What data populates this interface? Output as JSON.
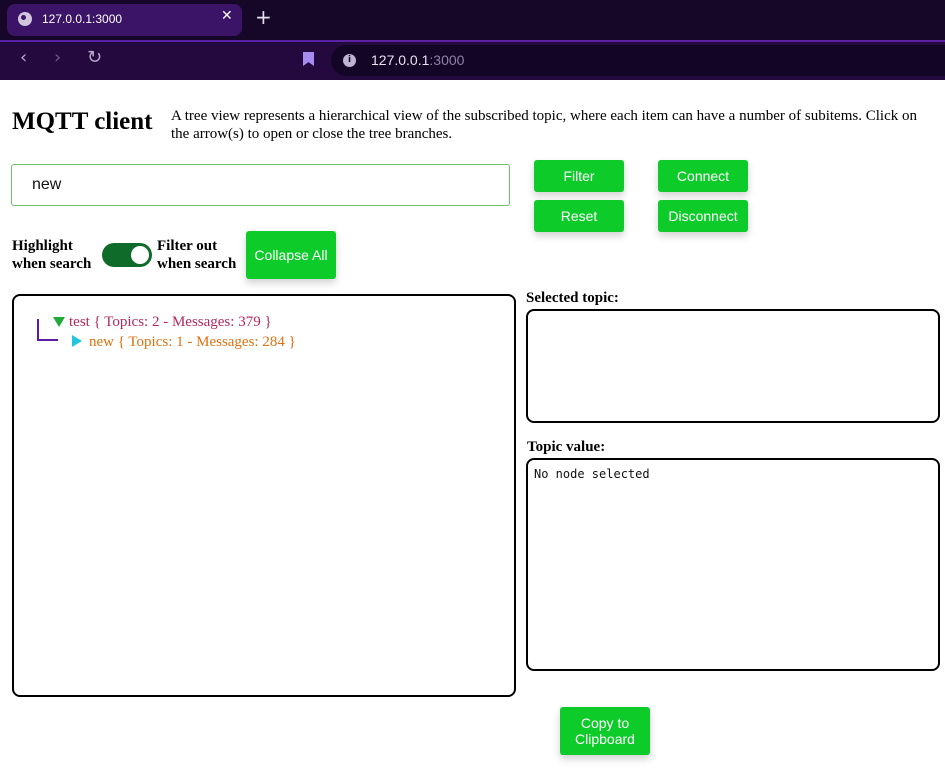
{
  "browser": {
    "tab_title": "127.0.0.1:3000",
    "tab_close": "✕",
    "new_tab": "+",
    "nav": {
      "back": "‹",
      "forward": "›",
      "reload": "↻"
    },
    "url_host": "127.0.0.1",
    "url_port": ":3000",
    "info_glyph": "i"
  },
  "header": {
    "title": "MQTT client",
    "description": "A tree view represents a hierarchical view of the subscribed topic, where each item can have a number of subitems. Click on the arrow(s) to open or close the tree branches."
  },
  "search": {
    "value": "new"
  },
  "buttons": {
    "filter": "Filter",
    "reset": "Reset",
    "connect": "Connect",
    "disconnect": "Disconnect",
    "collapse": "Collapse All",
    "copy": "Copy to Clipboard"
  },
  "labels": {
    "highlight": "Highlight when search",
    "filter_out": "Filter out when search"
  },
  "toggle": {
    "on": true
  },
  "tree": [
    {
      "label": "test { Topics: 2 - Messages: 379 }",
      "color": "#b3275f",
      "expanded": true
    },
    {
      "label": "new { Topics: 1 - Messages: 284 }",
      "color": "#e07010",
      "expanded": false
    }
  ],
  "selected_topic": {
    "label": "Selected topic:",
    "value": ""
  },
  "topic_value": {
    "label": "Topic value:",
    "value": "No node selected"
  },
  "colors": {
    "accent_green": "#0dcc2a",
    "browser_purple": "#24093f"
  }
}
